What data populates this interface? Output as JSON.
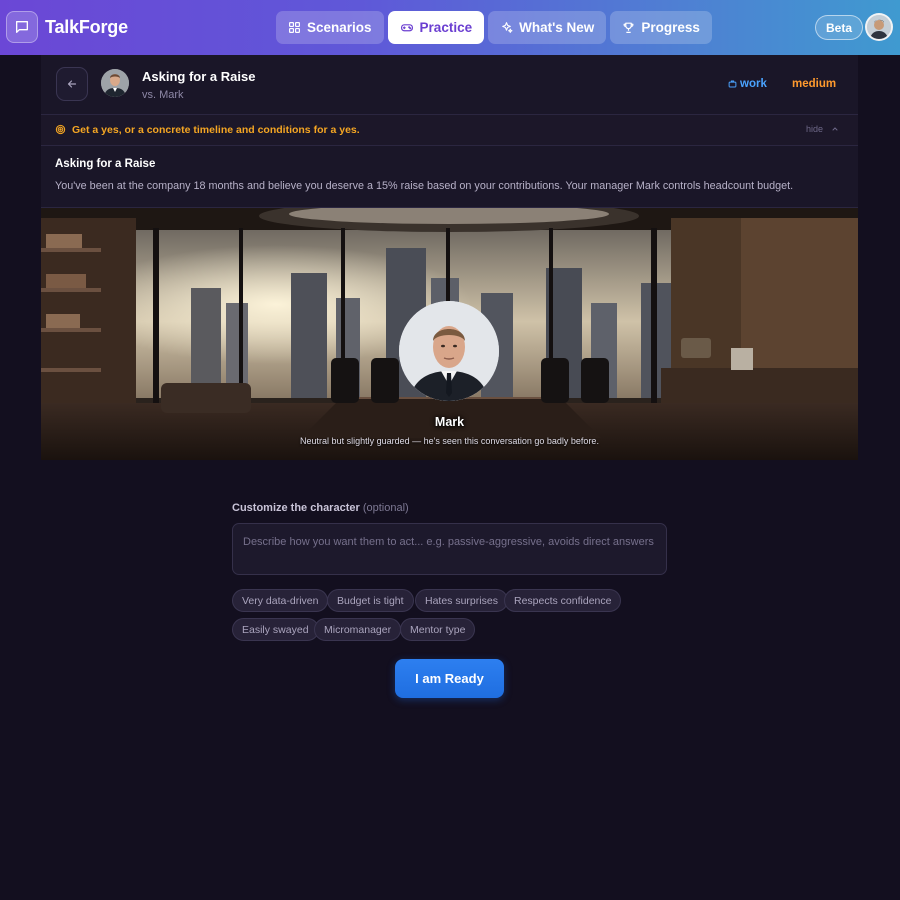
{
  "app": {
    "name": "TalkForge",
    "beta_label": "Beta"
  },
  "nav": {
    "tabs": [
      {
        "label": "Scenarios",
        "icon": "grid-icon",
        "active": false
      },
      {
        "label": "Practice",
        "icon": "gamepad-icon",
        "active": true
      },
      {
        "label": "What's New",
        "icon": "sparkle-icon",
        "active": false
      },
      {
        "label": "Progress",
        "icon": "trophy-icon",
        "active": false
      }
    ]
  },
  "scenario": {
    "title": "Asking for a Raise",
    "opponent": "vs. Mark",
    "category": "work",
    "difficulty": "medium",
    "goal": "Get a yes, or a concrete timeline and conditions for a yes.",
    "hide_label": "hide",
    "brief_title": "Asking for a Raise",
    "brief_description": "You've been at the company 18 months and believe you deserve a 15% raise based on your contributions. Your manager Mark controls headcount budget."
  },
  "character": {
    "name": "Mark",
    "description": "Neutral but slightly guarded — he's seen this conversation go badly before."
  },
  "customize": {
    "label": "Customize the character",
    "optional_label": "(optional)",
    "placeholder": "Describe how you want them to act... e.g. passive-aggressive, avoids direct answers",
    "value": "",
    "chips": [
      "Very data-driven",
      "Budget is tight",
      "Hates surprises",
      "Respects confidence",
      "Easily swayed",
      "Micromanager",
      "Mentor type"
    ]
  },
  "actions": {
    "ready_label": "I am Ready"
  },
  "colors": {
    "accent": "#6b3fd1",
    "primary_button": "#1f6ee0",
    "work_tag": "#4aa3ff",
    "medium_tag": "#ff9a2e",
    "goal_text": "#f5a623"
  }
}
